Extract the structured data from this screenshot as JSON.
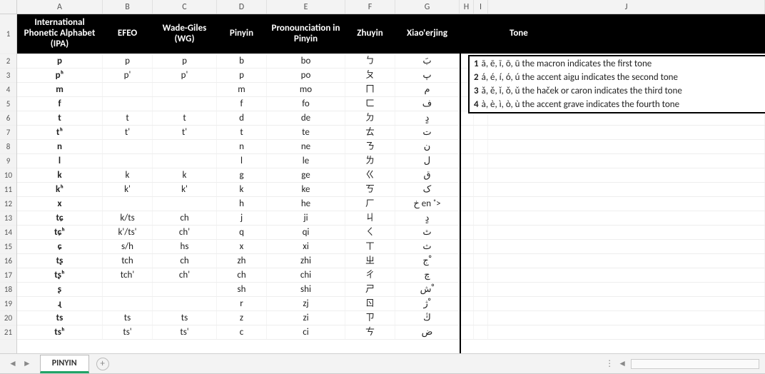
{
  "columns": [
    "A",
    "B",
    "C",
    "D",
    "E",
    "F",
    "G",
    "H",
    "I",
    "J"
  ],
  "row_numbers_header": "1",
  "headers": {
    "A": "International Phonetic Alphabet (IPA)",
    "B": "EFEO",
    "C": "Wade-Giles (WG)",
    "D": "Pinyin",
    "E": "Pronounciation in Pinyin",
    "F": "Zhuyin",
    "G": "Xiao'erjing",
    "H": "",
    "I": "",
    "J": "Tone"
  },
  "rows": [
    {
      "n": "2",
      "A": "p",
      "B": "p",
      "C": "p",
      "D": "b",
      "E": "bo",
      "F": "ㄅ",
      "G": "بَ"
    },
    {
      "n": "3",
      "A": "pʰ",
      "B": "p'",
      "C": "p'",
      "D": "p",
      "E": "po",
      "F": "ㄆ",
      "G": "پ"
    },
    {
      "n": "4",
      "A": "m",
      "B": "",
      "C": "",
      "D": "m",
      "E": "mo",
      "F": "ㄇ",
      "G": "م"
    },
    {
      "n": "5",
      "A": "f",
      "B": "",
      "C": "",
      "D": "f",
      "E": "fo",
      "F": "ㄈ",
      "G": "ف"
    },
    {
      "n": "6",
      "A": "t",
      "B": "t",
      "C": "t",
      "D": "d",
      "E": "de",
      "F": "ㄉ",
      "G": "دٍ"
    },
    {
      "n": "7",
      "A": "tʰ",
      "B": "t'",
      "C": "t'",
      "D": "t",
      "E": "te",
      "F": "ㄊ",
      "G": "ت"
    },
    {
      "n": "8",
      "A": "n",
      "B": "",
      "C": "",
      "D": "n",
      "E": "ne",
      "F": "ㄋ",
      "G": "ن"
    },
    {
      "n": "9",
      "A": "l",
      "B": "",
      "C": "",
      "D": "l",
      "E": "le",
      "F": "ㄌ",
      "G": "ل"
    },
    {
      "n": "10",
      "A": "k",
      "B": "k",
      "C": "k",
      "D": "g",
      "E": "ge",
      "F": "ㄍ",
      "G": "ق"
    },
    {
      "n": "11",
      "A": "kʰ",
      "B": "k'",
      "C": "k'",
      "D": "k",
      "E": "ke",
      "F": "ㄎ",
      "G": "ک"
    },
    {
      "n": "12",
      "A": "x",
      "B": "",
      "C": "",
      "D": "h",
      "E": "he",
      "F": "ㄏ",
      "G": "خ en ˚>"
    },
    {
      "n": "13",
      "A": "tɕ",
      "B": "k/ts",
      "C": "ch",
      "D": "j",
      "E": "ji",
      "F": "ㄐ",
      "G": "دٍ"
    },
    {
      "n": "14",
      "A": "tɕʰ",
      "B": "k'/ts'",
      "C": "ch'",
      "D": "q",
      "E": "qi",
      "F": "ㄑ",
      "G": "ٿ"
    },
    {
      "n": "15",
      "A": "ɕ",
      "B": "s/h",
      "C": "hs",
      "D": "x",
      "E": "xi",
      "F": "ㄒ",
      "G": "ث"
    },
    {
      "n": "16",
      "A": "tʂ",
      "B": "tch",
      "C": "ch",
      "D": "zh",
      "E": "zhi",
      "F": "ㄓ",
      "G": "ج ْ"
    },
    {
      "n": "17",
      "A": "tʂʰ",
      "B": "tch'",
      "C": "ch'",
      "D": "ch",
      "E": "chi",
      "F": "ㄔ",
      "G": "چ"
    },
    {
      "n": "18",
      "A": "ʂ",
      "B": "",
      "C": "",
      "D": "sh",
      "E": "shi",
      "F": "ㄕ",
      "G": "ش ْ"
    },
    {
      "n": "19",
      "A": "ɻ",
      "B": "",
      "C": "",
      "D": "r",
      "E": "zj",
      "F": "ㄖ",
      "G": "ژ ْ"
    },
    {
      "n": "20",
      "A": "ts",
      "B": "ts",
      "C": "ts",
      "D": "z",
      "E": "zi",
      "F": "ㄗ",
      "G": "ڭ"
    },
    {
      "n": "21",
      "A": "tsʰ",
      "B": "ts'",
      "C": "ts'",
      "D": "c",
      "E": "ci",
      "F": "ㄘ",
      "G": "ض"
    }
  ],
  "tone_box": [
    {
      "num": "1",
      "text": "ā, ē, ī, ō, ū the macron indicates the first tone"
    },
    {
      "num": "2",
      "text": "á, é, í, ó, ú the accent aigu indicates the second tone"
    },
    {
      "num": "3",
      "text": "ǎ, ě, ǐ, ǒ, ǔ the haček or caron indicates the third tone"
    },
    {
      "num": "4",
      "text": "à, è, ì, ò, ù the accent grave indicates the fourth tone"
    }
  ],
  "sheet_tab": "PINYIN",
  "nav": {
    "prev": "◄",
    "next": "►",
    "add": "+",
    "scroll_left": "◄",
    "dots": "⋮"
  }
}
